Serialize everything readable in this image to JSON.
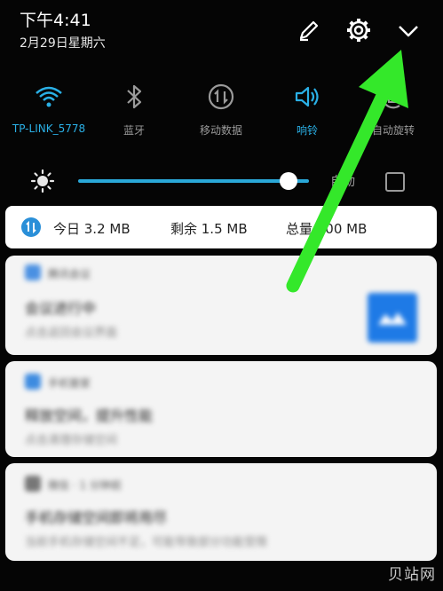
{
  "status": {
    "time": "下午4:41",
    "date": "2月29日星期六"
  },
  "header": {
    "edit_icon": "pencil-icon",
    "settings_icon": "gear-icon",
    "expand_icon": "chevron-down-icon"
  },
  "quick_settings": [
    {
      "label": "TP-LINK_5778",
      "icon": "wifi-icon",
      "active": true
    },
    {
      "label": "蓝牙",
      "icon": "bluetooth-icon",
      "active": false
    },
    {
      "label": "移动数据",
      "icon": "mobile-data-icon",
      "active": false
    },
    {
      "label": "响铃",
      "icon": "ring-volume-icon",
      "active": true
    },
    {
      "label": "自动旋转",
      "icon": "auto-rotate-icon",
      "active": false
    }
  ],
  "brightness": {
    "level": 0.91,
    "auto_label": "自动",
    "auto_checked": false
  },
  "data_usage": {
    "today": "今日 3.2 MB",
    "remaining": "剩余 1.5 MB",
    "total": "总量 100 MB"
  },
  "notifications": [
    {
      "app": "腾讯会议",
      "title": "会议进行中",
      "body": "点击返回会议界面"
    },
    {
      "app": "手机管家",
      "title": "释放空间，提升性能",
      "body": "点击清理存储空间"
    },
    {
      "app": "微信 · 1 分钟前",
      "title": "手机存储空间即将用尽",
      "body": "当前手机存储空间不足，可能导致部分功能受限"
    }
  ],
  "colors": {
    "accent": "#2ab0e6",
    "arrow": "#34e82a"
  },
  "watermark": "贝站网"
}
